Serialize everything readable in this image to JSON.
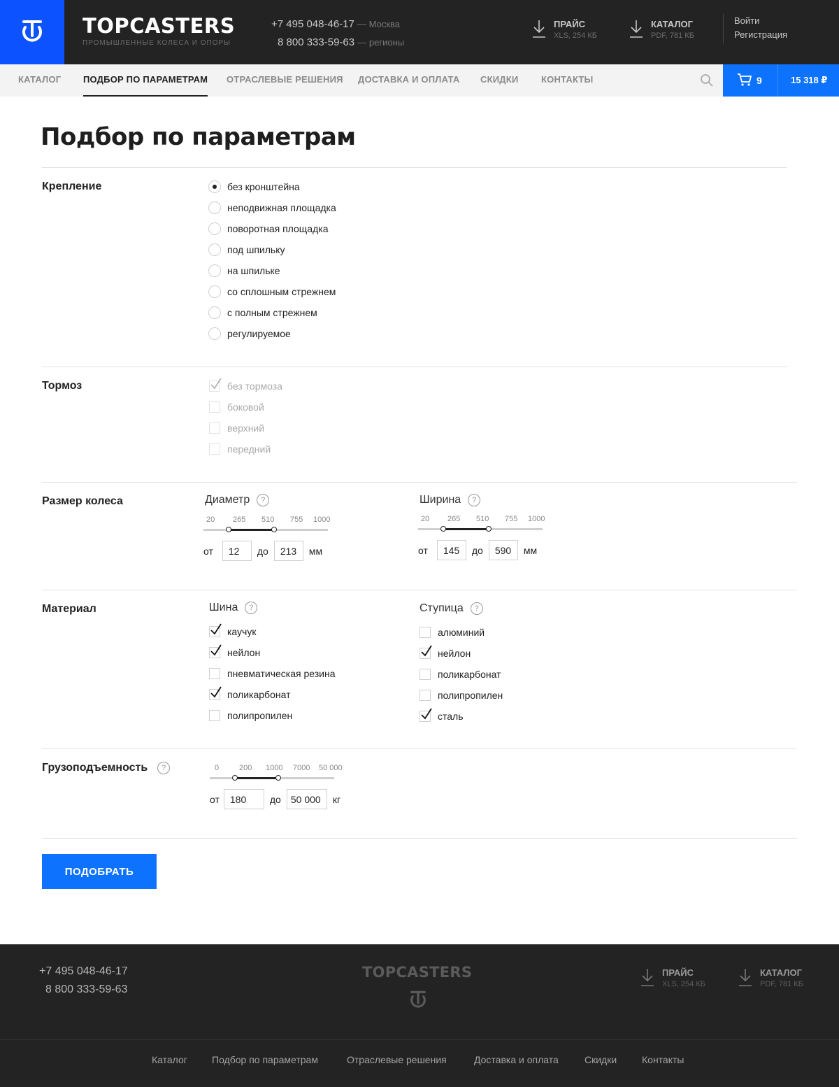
{
  "header": {
    "brand_name": "TOPCASTERS",
    "brand_sub": "ПРОМЫШЛЕННЫЕ КОЛЕСА И ОПОРЫ",
    "phone1": "+7 495 048-46-17",
    "phone1_city": "— Москва",
    "phone2": "8 800 333-59-63",
    "phone2_city": "— регионы",
    "price": {
      "title": "ПРАЙС",
      "meta": "XLS, 254 КБ"
    },
    "catalog": {
      "title": "КАТАЛОГ",
      "meta": "PDF, 781 КБ"
    },
    "login": "Войти",
    "register": "Регистрация"
  },
  "nav": {
    "items": [
      "КАТАЛОГ",
      "ПОДБОР ПО ПАРАМЕТРАМ",
      "ОТРАСЛЕВЫЕ РЕШЕНИЯ",
      "ДОСТАВКА И ОПЛАТА",
      "СКИДКИ",
      "КОНТАКТЫ"
    ],
    "active_index": 1
  },
  "cart": {
    "count": "9",
    "total": "15 318 ₽"
  },
  "page_title": "Подбор по параметрам",
  "mount": {
    "title": "Крепление",
    "options": [
      "без кронштейна",
      "неподвижная площадка",
      "поворотная площадка",
      "под шпильку",
      "на шпильке",
      "со сплошным стрежнем",
      "с полным стрежнем",
      "регулируемое"
    ],
    "selected_index": 0
  },
  "brake": {
    "title": "Тормоз",
    "options": [
      {
        "label": "без тормоза",
        "checked": true
      },
      {
        "label": "боковой",
        "checked": false
      },
      {
        "label": "верхний",
        "checked": false
      },
      {
        "label": "передний",
        "checked": false
      }
    ],
    "disabled": true
  },
  "wheel_size": {
    "title": "Размер колеса",
    "diameter": {
      "label": "Диаметр",
      "help": "?",
      "scale": [
        "20",
        "265",
        "510",
        "755",
        "1000"
      ],
      "from_label": "от",
      "from": "12",
      "to_label": "до",
      "to": "213",
      "unit": "мм",
      "selected_range_fraction": [
        0.2,
        0.57
      ]
    },
    "width": {
      "label": "Ширина",
      "help": "?",
      "scale": [
        "20",
        "265",
        "510",
        "755",
        "1000"
      ],
      "from_label": "от",
      "from": "145",
      "to_label": "до",
      "to": "590",
      "unit": "мм",
      "selected_range_fraction": [
        0.2,
        0.57
      ]
    }
  },
  "material": {
    "title": "Материал",
    "tire": {
      "label": "Шина",
      "help": "?",
      "options": [
        {
          "label": "каучук",
          "checked": true
        },
        {
          "label": "нейлон",
          "checked": true
        },
        {
          "label": "пневматическая резина",
          "checked": false
        },
        {
          "label": "поликарбонат",
          "checked": true
        },
        {
          "label": "полипропилен",
          "checked": false
        }
      ]
    },
    "hub": {
      "label": "Ступица",
      "help": "?",
      "options": [
        {
          "label": "алюминий",
          "checked": false
        },
        {
          "label": "нейлон",
          "checked": true
        },
        {
          "label": "поликарбонат",
          "checked": false
        },
        {
          "label": "полипропилен",
          "checked": false
        },
        {
          "label": "сталь",
          "checked": true
        }
      ]
    }
  },
  "load": {
    "title": "Грузоподъемность",
    "help": "?",
    "scale": [
      "0",
      "200",
      "1000",
      "7000",
      "50 000"
    ],
    "from_label": "от",
    "from": "180",
    "to_label": "до",
    "to": "50 000",
    "unit": "кг",
    "selected_range_fraction": [
      0.2,
      0.55
    ]
  },
  "submit_label": "ПОДОБРАТЬ",
  "footer": {
    "phone1": "+7 495 048-46-17",
    "phone2": "8 800 333-59-63",
    "brand_name": "TOPCASTERS",
    "price": {
      "title": "ПРАЙС",
      "meta": "XLS, 254 КБ"
    },
    "catalog": {
      "title": "КАТАЛОГ",
      "meta": "PDF, 781 КБ"
    },
    "links": [
      "Каталог",
      "Подбор по параметрам",
      "Отраслевые решения",
      "Доставка и оплата",
      "Скидки",
      "Контакты"
    ]
  },
  "colors": {
    "brand_blue": "#0d52ff",
    "accent_blue": "#0d73ff",
    "dark_bg": "#232323"
  },
  "icons": [
    "logo-icon",
    "download-icon",
    "search-icon",
    "cart-icon",
    "help-icon",
    "check-icon"
  ]
}
